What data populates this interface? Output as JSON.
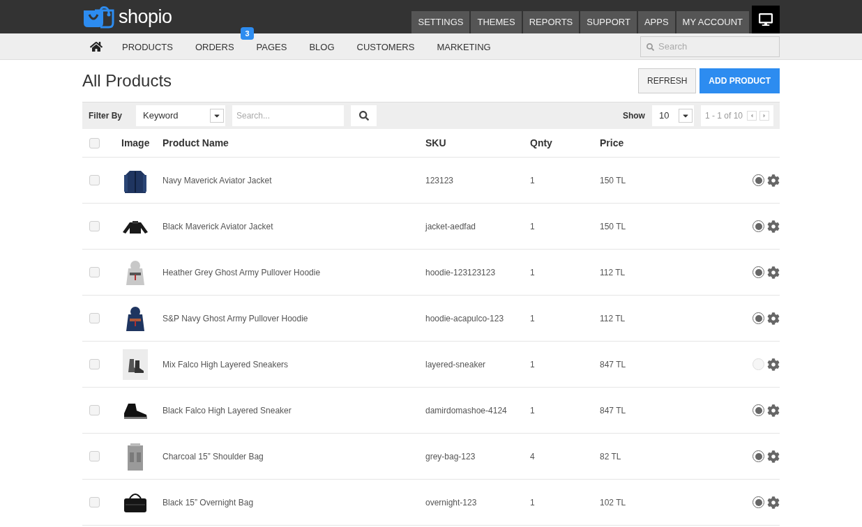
{
  "brand": {
    "name": "shopio"
  },
  "top_menu": [
    {
      "label": "SETTINGS"
    },
    {
      "label": "THEMES"
    },
    {
      "label": "REPORTS"
    },
    {
      "label": "SUPPORT"
    },
    {
      "label": "APPS"
    },
    {
      "label": "MY ACCOUNT"
    }
  ],
  "nav": [
    {
      "label": "PRODUCTS"
    },
    {
      "label": "ORDERS",
      "badge": "3"
    },
    {
      "label": "PAGES"
    },
    {
      "label": "BLOG"
    },
    {
      "label": "CUSTOMERS"
    },
    {
      "label": "MARKETING"
    }
  ],
  "nav_search": {
    "placeholder": "Search"
  },
  "title": "All Products",
  "buttons": [
    {
      "label": "REFRESH",
      "kind": "secondary"
    },
    {
      "label": "ADD PRODUCT",
      "kind": "primary"
    }
  ],
  "filter": {
    "label": "Filter By",
    "select": "Keyword",
    "placeholder": "Search...",
    "show_label": "Show",
    "show_value": "10",
    "range": "1 - 1 of 10"
  },
  "table": {
    "select_all": {
      "checked": false
    },
    "columns": [
      "Image",
      "Product Name",
      "SKU",
      "Qnty",
      "Price"
    ],
    "rows": [
      {
        "name": "Navy Maverick Aviator Jacket",
        "sku": "123123",
        "qnty": "1",
        "price": "150 TL",
        "checked": false,
        "active": true
      },
      {
        "name": "Black Maverick Aviator Jacket",
        "sku": "jacket-aedfad",
        "qnty": "1",
        "price": "150 TL",
        "checked": false,
        "active": true
      },
      {
        "name": "Heather Grey Ghost Army Pullover Hoodie",
        "sku": "hoodie-123123123",
        "qnty": "1",
        "price": "112 TL",
        "checked": false,
        "active": true
      },
      {
        "name": "S&P Navy Ghost Army Pullover Hoodie",
        "sku": "hoodie-acapulco-123",
        "qnty": "1",
        "price": "112 TL",
        "checked": false,
        "active": true
      },
      {
        "name": "Mix Falco High Layered Sneakers",
        "sku": "layered-sneaker",
        "qnty": "1",
        "price": "847 TL",
        "checked": false,
        "active": false
      },
      {
        "name": "Black Falco High Layered Sneaker",
        "sku": "damirdomashoe-4124",
        "qnty": "1",
        "price": "847 TL",
        "checked": false,
        "active": true
      },
      {
        "name": "Charcoal 15” Shoulder Bag",
        "sku": "grey-bag-123",
        "qnty": "4",
        "price": "82 TL",
        "checked": false,
        "active": true
      },
      {
        "name": "Black 15” Overnight Bag",
        "sku": "overnight-123",
        "qnty": "1",
        "price": "102 TL",
        "checked": false,
        "active": true
      }
    ]
  }
}
